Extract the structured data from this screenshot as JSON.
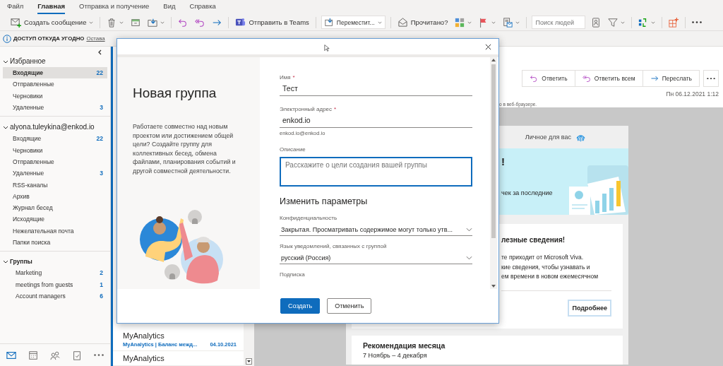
{
  "menu_tabs": [
    {
      "label": "Файл",
      "selected": false
    },
    {
      "label": "Главная",
      "selected": true
    },
    {
      "label": "Отправка и получение",
      "selected": false
    },
    {
      "label": "Вид",
      "selected": false
    },
    {
      "label": "Справка",
      "selected": false
    }
  ],
  "toolbar": {
    "groups": [
      [
        {
          "kind": "button",
          "label": "Создать сообщение",
          "caret": true
        }
      ],
      [
        {
          "kind": "icon",
          "caret": true
        },
        {
          "kind": "icon",
          "caret": false
        },
        {
          "kind": "icon",
          "caret": true
        }
      ],
      [
        {
          "kind": "icon",
          "caret": false
        },
        {
          "kind": "icon",
          "caret": false
        },
        {
          "kind": "icon",
          "caret": false
        }
      ],
      [
        {
          "kind": "button",
          "label": "Отправить в Teams",
          "caret": false
        }
      ],
      [
        {
          "kind": "combo",
          "label": "Переместит...",
          "caret": true
        }
      ],
      [
        {
          "kind": "button",
          "label": "Прочитано?",
          "caret": false
        },
        {
          "kind": "icon",
          "caret": true
        },
        {
          "kind": "icon",
          "caret": true
        },
        {
          "kind": "icon",
          "caret": true
        }
      ],
      [
        {
          "kind": "search",
          "placeholder": "Поиск людей"
        },
        {
          "kind": "icon",
          "caret": false
        },
        {
          "kind": "icon",
          "caret": true
        }
      ],
      [
        {
          "kind": "icon",
          "caret": true
        }
      ],
      [
        {
          "kind": "icon",
          "caret": false
        }
      ],
      [
        {
          "kind": "icon",
          "caret": false
        }
      ]
    ]
  },
  "infobar": {
    "title": "ДОСТУП ОТКУДА УГОДНО",
    "link": "Остава"
  },
  "sidebar": {
    "sections": [
      {
        "label": "Избранное",
        "expanded": true,
        "items": [
          {
            "label": "Входящие",
            "count": "22",
            "selected": true
          },
          {
            "label": "Отправленные",
            "selected": false
          },
          {
            "label": "Черновики",
            "selected": false
          },
          {
            "label": "Удаленные",
            "count": "3",
            "selected": false
          }
        ]
      },
      {
        "label": "alyona.tuleykina@enkod.io",
        "expanded": true,
        "items": [
          {
            "label": "Входящие",
            "count": "22",
            "selected": false
          },
          {
            "label": "Черновики",
            "selected": false
          },
          {
            "label": "Отправленные",
            "selected": false
          },
          {
            "label": "Удаленные",
            "count": "3",
            "selected": false
          },
          {
            "label": "RSS-каналы",
            "selected": false
          },
          {
            "label": "Архив",
            "selected": false
          },
          {
            "label": "Журнал бесед",
            "selected": false
          },
          {
            "label": "Исходящие",
            "selected": false
          },
          {
            "label": "Нежелательная почта",
            "selected": false
          },
          {
            "label": "Папки поиска",
            "selected": false
          }
        ]
      },
      {
        "label": "Группы",
        "expanded": true,
        "items": [
          {
            "label": "Marketing",
            "count": "2",
            "selected": false
          },
          {
            "label": "meetings from guests",
            "count": "1",
            "selected": false
          },
          {
            "label": "Account managers",
            "count": "6",
            "selected": false
          }
        ]
      }
    ],
    "nav": [
      {
        "selected": true
      },
      {
        "selected": false
      },
      {
        "selected": false
      },
      {
        "selected": false
      },
      {
        "selected": false
      }
    ]
  },
  "message_list": {
    "rows": [
      {
        "sender": "MyAnalytics",
        "subject": "MyAnalytics | Баланс межд...",
        "date": "04.10.2021"
      },
      {
        "sender": "MyAnalytics"
      }
    ]
  },
  "reading_pane": {
    "actions": [
      {
        "label": "Ответить"
      },
      {
        "label": "Ответить всем"
      },
      {
        "label": "Переслать"
      }
    ],
    "date": "Пн 06.12.2021 1:12",
    "notice": "о в веб-браузере.",
    "email": {
      "header": "Личное для вас",
      "banner_title": "!",
      "banner_text": "чек за последние",
      "insight_title": "лезные сведения!",
      "insight_text": "те приходит от Microsoft Viva.\nкие сведения, чтобы узнавать и\nем времени в новом ежемесячном",
      "insight_button": "Подробнее",
      "recommendation_title": "Рекомендация месяца",
      "recommendation_dates": "7 Ноябрь – 4 декабря"
    }
  },
  "dialog": {
    "title": "Новая группа",
    "intro": "Работаете совместно над новым проектом или достижением общей цели? Создайте группу для коллективных бесед, обмена файлами, планирования событий и другой совместной деятельности.",
    "fields": [
      {
        "kind": "text",
        "label": "Имя",
        "required_mark": "*",
        "value": "Тест"
      },
      {
        "kind": "text",
        "label": "Электронный адрес",
        "required_mark": "*",
        "value": "enkod.io",
        "hint": "enkod.io@enkod.io"
      },
      {
        "kind": "textarea",
        "label": "Описание",
        "placeholder": "Расскажите о цели создания вашей группы",
        "focused": true
      }
    ],
    "section_title": "Изменить параметры",
    "settings": [
      {
        "kind": "select",
        "label": "Конфиденциальность",
        "value": "Закрытая. Просматривать содержимое могут только утв..."
      },
      {
        "kind": "select",
        "label": "Язык уведомлений, связанных с группой",
        "value": "русский (Россия)"
      },
      {
        "kind": "label",
        "label": "Подписка"
      }
    ],
    "buttons": [
      {
        "label": "Создать",
        "primary": true
      },
      {
        "label": "Отменить",
        "primary": false
      }
    ]
  }
}
